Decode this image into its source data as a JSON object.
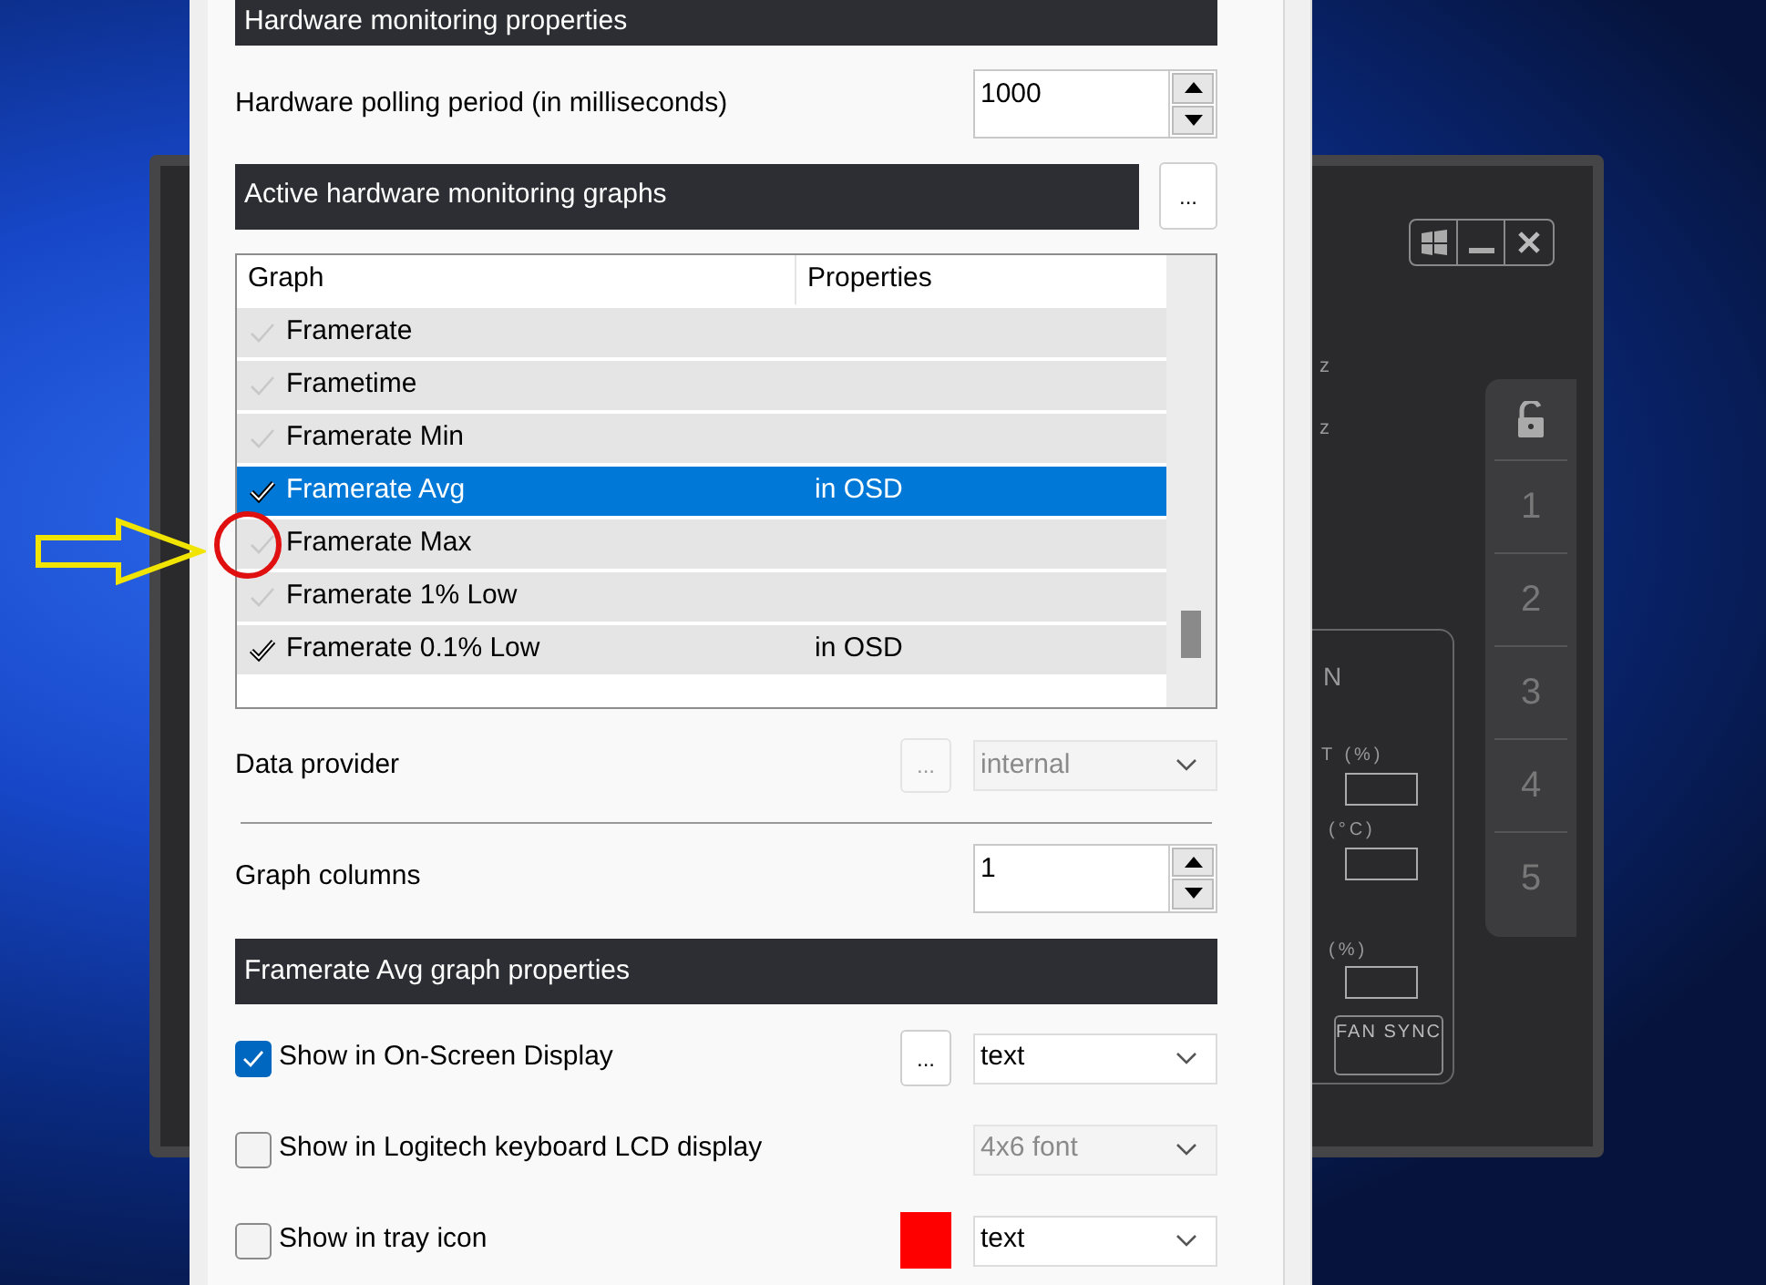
{
  "dialog": {
    "section_header": "Hardware monitoring properties",
    "polling": {
      "label": "Hardware polling period (in milliseconds)",
      "value": "1000"
    },
    "graphs_header": "Active hardware monitoring graphs",
    "graphs_button": "...",
    "graphs_table": {
      "columns": [
        "Graph",
        "Properties"
      ],
      "rows": [
        {
          "graph": "Framerate",
          "checked": false,
          "selected": false
        },
        {
          "graph": "Frametime",
          "checked": false,
          "selected": false
        },
        {
          "graph": "Framerate Min",
          "checked": false,
          "selected": false
        },
        {
          "graph": "Framerate Avg",
          "properties": "in OSD",
          "checked": true,
          "selected": true
        },
        {
          "graph": "Framerate Max",
          "checked": false,
          "selected": false
        },
        {
          "graph": "Framerate 1% Low",
          "checked": false,
          "selected": false
        },
        {
          "graph": "Framerate 0.1% Low",
          "properties": "in OSD",
          "checked": true,
          "selected": false
        }
      ]
    },
    "data_provider": {
      "label": "Data provider",
      "button": "...",
      "button_disabled": true,
      "value": "internal",
      "disabled": true
    },
    "graph_columns": {
      "label": "Graph columns",
      "value": "1"
    },
    "graph_properties_header": "Framerate Avg graph properties",
    "options": [
      {
        "kind": "button",
        "label": "Show in On-Screen Display",
        "checked": true,
        "button": "...",
        "value": "text",
        "disabled": false
      },
      {
        "kind": "plain",
        "label": "Show in Logitech keyboard LCD display",
        "checked": false,
        "value": "4x6 font",
        "disabled": true
      },
      {
        "kind": "color",
        "label": "Show in tray icon",
        "checked": false,
        "color": "#ff0000",
        "value": "text",
        "disabled": false
      }
    ]
  },
  "app": {
    "labels": [
      "z",
      "z",
      "N",
      "T (%)",
      "(°C)",
      "(%)"
    ],
    "fan_button": "FAN SYNC",
    "profiles": [
      "1",
      "2",
      "3",
      "4",
      "5"
    ]
  }
}
